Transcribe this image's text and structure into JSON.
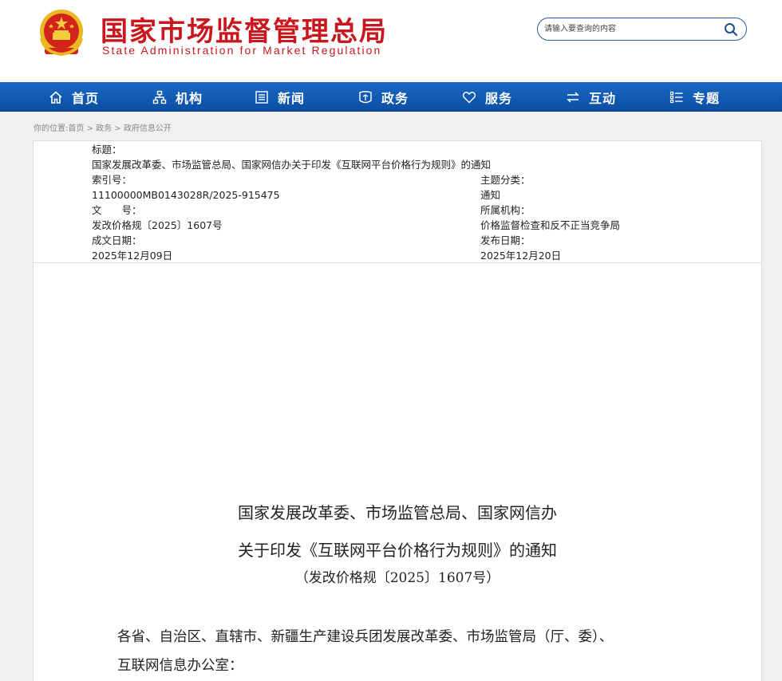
{
  "header": {
    "title": "国家市场监督管理总局",
    "subtitle": "State Administration for Market Regulation",
    "search_placeholder": "请输入要查询的内容",
    "brand_color": "#c9171e"
  },
  "nav": {
    "items": [
      {
        "label": "首页",
        "icon": "home-icon"
      },
      {
        "label": "机构",
        "icon": "org-chart-icon"
      },
      {
        "label": "新闻",
        "icon": "news-icon"
      },
      {
        "label": "政务",
        "icon": "government-icon"
      },
      {
        "label": "服务",
        "icon": "heart-icon"
      },
      {
        "label": "互动",
        "icon": "exchange-icon"
      },
      {
        "label": "专题",
        "icon": "list-icon"
      }
    ],
    "bg_color": "#0b56ad"
  },
  "breadcrumb": {
    "prefix": "你的位置:",
    "items": [
      "首页",
      "政务",
      "政府信息公开"
    ],
    "separator": " > "
  },
  "meta": {
    "title_label": "标题：",
    "title_value": "国家发展改革委、市场监管总局、国家网信办关于印发《互联网平台价格行为规则》的通知",
    "index_label": "索引号：",
    "index_value": "11100000MB0143028R/2025-915475",
    "category_label": "主题分类：",
    "category_value": "通知",
    "docno_label": "文　　号：",
    "docno_value": "发改价格规〔2025〕1607号",
    "org_label": "所属机构：",
    "org_value": "价格监督检查和反不正当竞争局",
    "created_label": "成文日期：",
    "created_value": "2025年12月09日",
    "published_label": "发布日期：",
    "published_value": "2025年12月20日"
  },
  "document": {
    "title_line1": "国家发展改革委、市场监管总局、国家网信办",
    "title_line2": "关于印发《互联网平台价格行为规则》的通知",
    "number": "（发改价格规〔2025〕1607号）",
    "para1_line1": "各省、自治区、直辖市、新疆生产建设兵团发展改革委、市场监管局（厅、委）、",
    "para1_line2": "互联网信息办公室："
  }
}
